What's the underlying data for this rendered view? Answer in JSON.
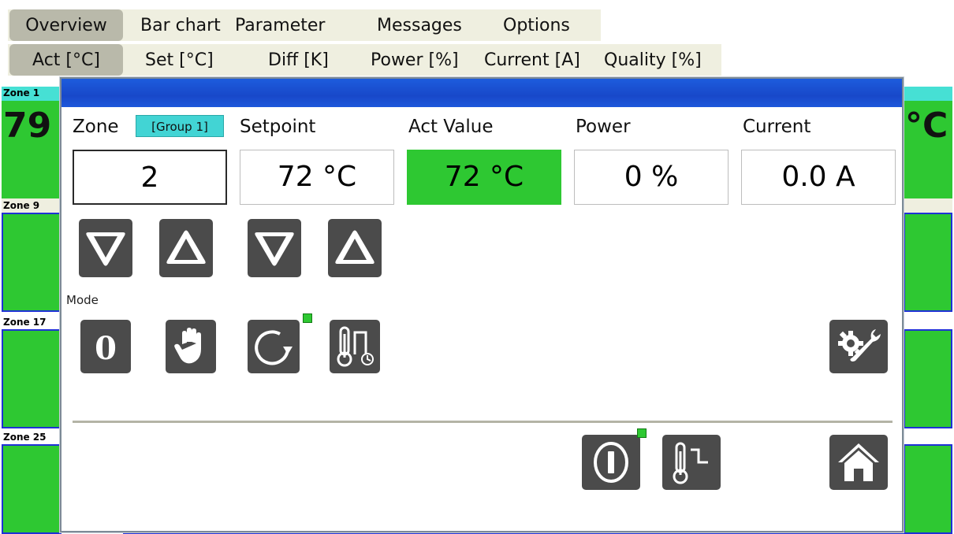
{
  "menu": {
    "items": [
      "Overview",
      "Bar chart",
      "Parameter",
      "Messages",
      "Options"
    ],
    "active": "Overview"
  },
  "submenu": {
    "items": [
      "Act [°C]",
      "Set [°C]",
      "Diff [K]",
      "Power [%]",
      "Current [A]",
      "Quality [%]"
    ],
    "active": "Act [°C]"
  },
  "zones": {
    "labels": [
      "Zone 1",
      "Zone 9",
      "Zone 17",
      "Zone 25"
    ],
    "zone1_value": "79",
    "unit_peek": "°C",
    "colors": {
      "ok": "#2ec832",
      "border": "#1f31d6",
      "zone1_band": "#46e0d4"
    }
  },
  "dialog": {
    "headers": {
      "zone": "Zone",
      "group": "[Group 1]",
      "setpoint": "Setpoint",
      "act_value": "Act Value",
      "power": "Power",
      "current": "Current"
    },
    "values": {
      "zone": "2",
      "setpoint": "72 °C",
      "act_value": "72 °C",
      "power": "0 %",
      "current": "0.0 A"
    },
    "mode_label": "Mode",
    "icons": {
      "zone_down": "triangle-down-icon",
      "zone_up": "triangle-up-icon",
      "set_down": "triangle-down-icon",
      "set_up": "triangle-up-icon",
      "mode_off": "zero-icon",
      "mode_manual": "hand-icon",
      "mode_auto": "loop-arrow-icon",
      "mode_temp_pulse": "thermometer-pulse-icon",
      "settings": "gear-wrench-icon",
      "power": "power-icon",
      "heating": "thermometer-step-icon",
      "home": "home-icon"
    },
    "colors": {
      "title_bar": "#1d5cdd",
      "group_chip": "#42d4d4",
      "act_value_bg": "#2ec832",
      "button": "#4b4b4b",
      "indicator": "#2ec832"
    }
  }
}
